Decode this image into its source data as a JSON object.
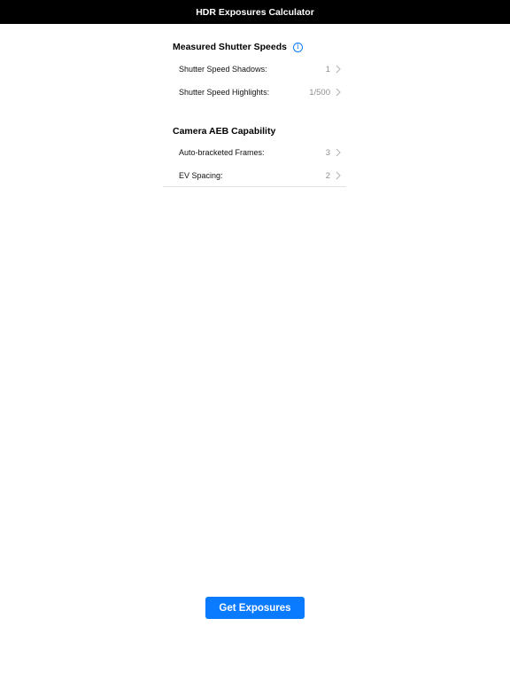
{
  "navbar": {
    "title": "HDR Exposures Calculator"
  },
  "sections": [
    {
      "title": "Measured Shutter Speeds",
      "has_info_icon": true,
      "rows": [
        {
          "label": "Shutter Speed Shadows:",
          "value": "1"
        },
        {
          "label": "Shutter Speed Highlights:",
          "value": "1/500"
        }
      ]
    },
    {
      "title": "Camera AEB Capability",
      "has_info_icon": false,
      "rows": [
        {
          "label": "Auto-bracketed Frames:",
          "value": "3"
        },
        {
          "label": "EV Spacing:",
          "value": "2"
        }
      ]
    }
  ],
  "icons": {
    "info": "info-icon",
    "chevron": "chevron-right-icon"
  },
  "colors": {
    "navbar_background": "#000000",
    "accent": "#0a7aff",
    "secondary_text": "#8e8e93"
  },
  "action_button": {
    "label": "Get Exposures"
  }
}
